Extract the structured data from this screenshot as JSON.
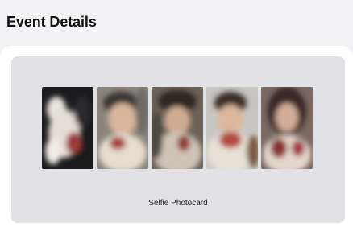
{
  "page": {
    "title": "Event Details"
  },
  "product": {
    "caption": "Selfie Photocard",
    "photos": [
      {
        "icon": "photocard-portrait-1"
      },
      {
        "icon": "photocard-portrait-2"
      },
      {
        "icon": "photocard-portrait-3"
      },
      {
        "icon": "photocard-portrait-4"
      },
      {
        "icon": "photocard-portrait-5"
      }
    ]
  },
  "colors": {
    "page_bg": "#f2f2f5",
    "card_bg": "#ffffff",
    "panel_bg": "#e1e1e6",
    "title_text": "#111111"
  }
}
